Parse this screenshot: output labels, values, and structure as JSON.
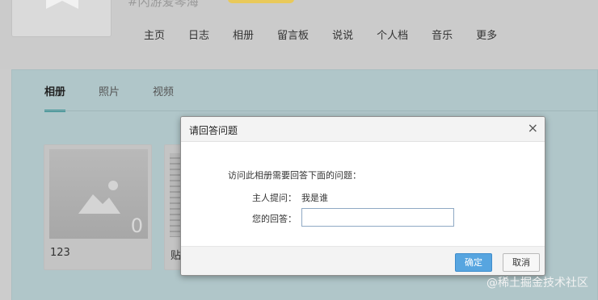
{
  "header": {
    "site_name": "#闪游爱琴海",
    "nav": [
      "主页",
      "日志",
      "相册",
      "留言板",
      "说说",
      "个人档",
      "音乐",
      "更多"
    ]
  },
  "tabs": [
    "相册",
    "照片",
    "视频"
  ],
  "albums": [
    {
      "name": "123",
      "count": "0"
    },
    {
      "name": "贴"
    }
  ],
  "dialog": {
    "title": "请回答问题",
    "close": "×",
    "prompt": "访问此相册需要回答下面的问题：",
    "question_label": "主人提问：",
    "question": "我是谁",
    "answer_label": "您的回答：",
    "answer_value": "",
    "ok_label": "确定",
    "cancel_label": "取消"
  },
  "watermark": "@稀土掘金技术社区",
  "colors": {
    "accent": "#2a8c8f",
    "ok_button": "#57a5e0"
  }
}
